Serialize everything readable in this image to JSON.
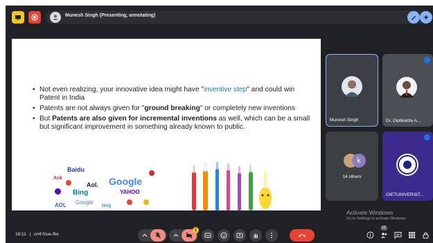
{
  "topbar": {
    "presenter_text": "Munesh Singh (Presenting, annotating)"
  },
  "slide": {
    "bullets": [
      {
        "before": "Not even realizing, your innovative idea might have \"",
        "highlight": "inventive step",
        "after": "\" and could win Patent in India"
      },
      {
        "before": "Patents are not always given for \"",
        "bold": "ground breaking",
        "after": "\" or completely new inventions"
      },
      {
        "before": "But ",
        "bold": "Patents are also given for incremental inventions",
        "after": " as well, which can be a small but significant improvement in something already known to public."
      }
    ],
    "logos": [
      "Baidu",
      "Google",
      "Aol.",
      "Bing",
      "YAHOO",
      "Google",
      "AOL",
      "bing",
      "Ask"
    ]
  },
  "participants": [
    {
      "name": "Munesh Singh"
    },
    {
      "name": "Dr. Diptikanta A..."
    },
    {
      "name": "14 others",
      "avatar_letter": "k"
    },
    {
      "name": "GIETUNIVERSIT..."
    }
  ],
  "watermark": {
    "title": "Activate Windows",
    "subtitle": "Go to Settings to activate Windows."
  },
  "bottombar": {
    "time": "18:11",
    "separator": "|",
    "meeting_code": "cmf-fcue-fbx",
    "camera_badge": "1",
    "people_count": "16"
  },
  "colors": {
    "accent": "#8ab4f8",
    "end_call": "#ea4335",
    "muted": "#f28b82",
    "highlight_text": "#1a7f9a"
  }
}
